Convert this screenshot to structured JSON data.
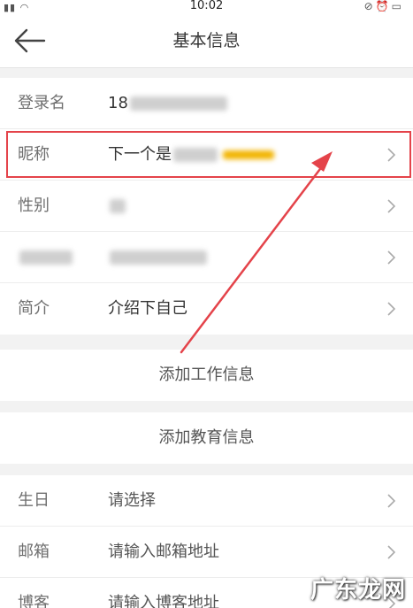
{
  "status_bar": {
    "time": "10:02"
  },
  "navbar": {
    "title": "基本信息"
  },
  "profile": {
    "login_label": "登录名",
    "login_value": "18",
    "nickname_label": "昵称",
    "nickname_value": "下一个是",
    "gender_label": "性别",
    "intro_label": "简介",
    "intro_value": "介绍下自己"
  },
  "actions": {
    "add_work": "添加工作信息",
    "add_education": "添加教育信息"
  },
  "extra": {
    "birthday_label": "生日",
    "birthday_value": "请选择",
    "email_label": "邮箱",
    "email_value": "请输入邮箱地址",
    "blog_label": "博客",
    "blog_value": "请输入博客地址"
  },
  "watermark": "广东龙网",
  "colors": {
    "highlight": "#e4434a",
    "nickname_blur": "#f2b400"
  }
}
